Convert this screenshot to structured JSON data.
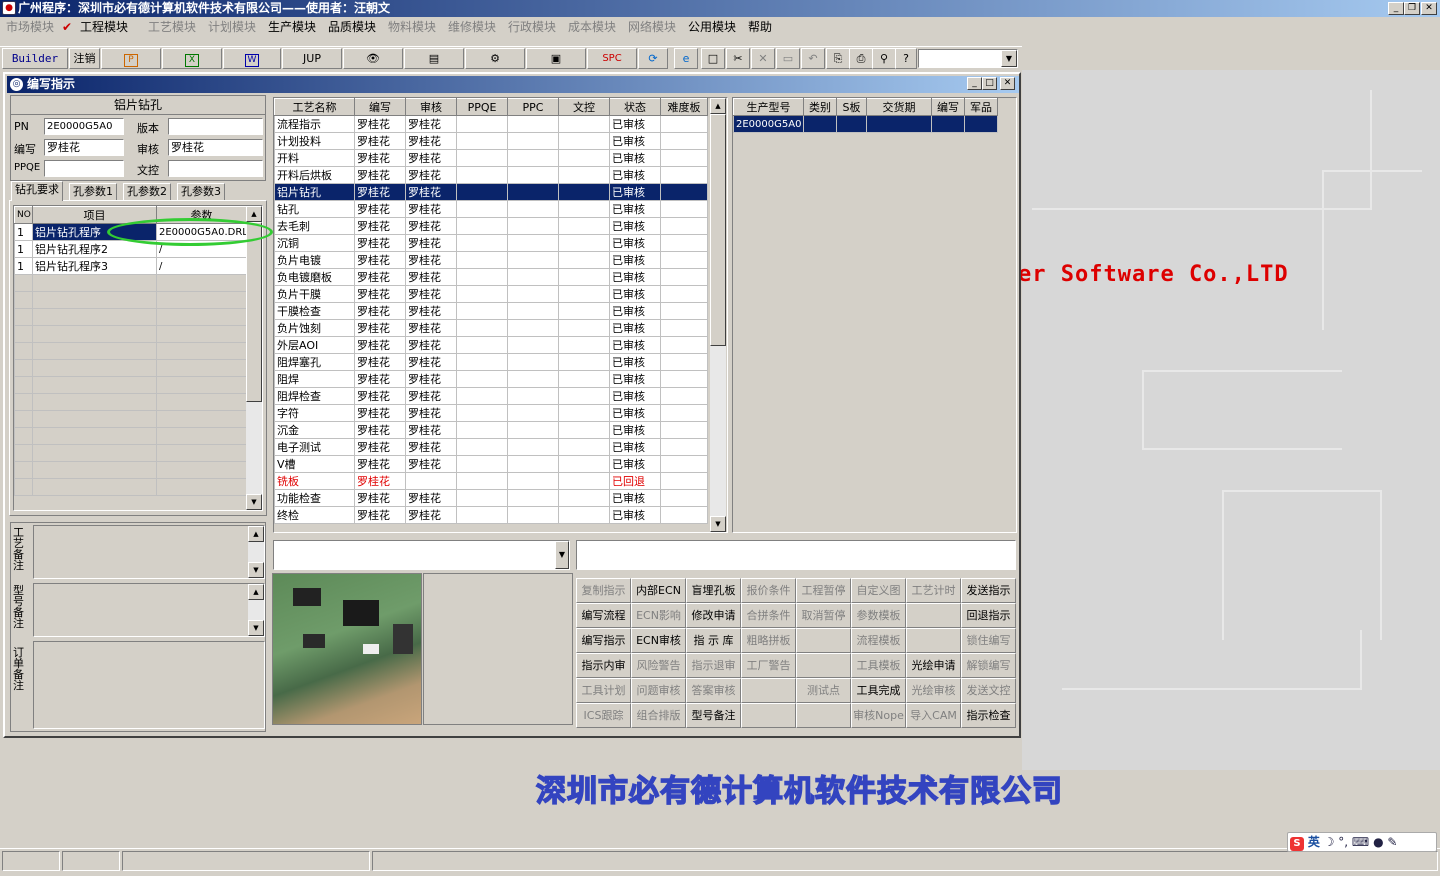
{
  "title": "广州程序：深圳市必有德计算机软件技术有限公司——使用者：汪朝文",
  "menu": [
    {
      "label": "市场模块",
      "enabled": false
    },
    {
      "label": "工程模块",
      "enabled": true
    },
    {
      "label": "工艺模块",
      "enabled": false
    },
    {
      "label": "计划模块",
      "enabled": false
    },
    {
      "label": "生产模块",
      "enabled": true
    },
    {
      "label": "品质模块",
      "enabled": true
    },
    {
      "label": "物料模块",
      "enabled": false
    },
    {
      "label": "维修模块",
      "enabled": false
    },
    {
      "label": "行政模块",
      "enabled": false
    },
    {
      "label": "成本模块",
      "enabled": false
    },
    {
      "label": "网络模块",
      "enabled": false
    },
    {
      "label": "公用模块",
      "enabled": true
    },
    {
      "label": "帮助",
      "enabled": true
    }
  ],
  "toolbar": {
    "builder": "Builder",
    "logout": "注销",
    "jup": "JUP",
    "spc": "SPC"
  },
  "child": {
    "title": "编写指示"
  },
  "left": {
    "header": "铝片钻孔",
    "pn_label": "PN",
    "pn_value": "2E0000G5A0",
    "version_label": "版本",
    "version_value": "",
    "author_label": "编写",
    "author_value": "罗桂花",
    "review_label": "审核",
    "review_value": "罗桂花",
    "ppqe_label": "PPQE",
    "ppqe_value": "",
    "wenkong_label": "文控",
    "wenkong_value": ""
  },
  "tabs": [
    "钻孔要求",
    "孔参数1",
    "孔参数2",
    "孔参数3"
  ],
  "drill": {
    "headers": [
      "NO",
      "项目",
      "参数"
    ],
    "rows": [
      {
        "no": "1",
        "item": "铝片钻孔程序",
        "param": "2E0000G5A0.DRL"
      },
      {
        "no": "1",
        "item": "铝片钻孔程序2",
        "param": "/"
      },
      {
        "no": "1",
        "item": "铝片钻孔程序3",
        "param": "/"
      }
    ]
  },
  "notes": {
    "process": "工艺备注",
    "model": "型号备注",
    "order": "订单备注"
  },
  "proc": {
    "headers": [
      "工艺名称",
      "编写",
      "审核",
      "PPQE",
      "PPC",
      "文控",
      "状态",
      "难度板"
    ],
    "rows": [
      {
        "name": "流程指示",
        "a": "罗桂花",
        "r": "罗桂花",
        "s": "已审核"
      },
      {
        "name": "计划投料",
        "a": "罗桂花",
        "r": "罗桂花",
        "s": "已审核"
      },
      {
        "name": "开料",
        "a": "罗桂花",
        "r": "罗桂花",
        "s": "已审核"
      },
      {
        "name": "开料后烘板",
        "a": "罗桂花",
        "r": "罗桂花",
        "s": "已审核"
      },
      {
        "name": "铝片钻孔",
        "a": "罗桂花",
        "r": "罗桂花",
        "s": "已审核"
      },
      {
        "name": "钻孔",
        "a": "罗桂花",
        "r": "罗桂花",
        "s": "已审核"
      },
      {
        "name": "去毛刺",
        "a": "罗桂花",
        "r": "罗桂花",
        "s": "已审核"
      },
      {
        "name": "沉铜",
        "a": "罗桂花",
        "r": "罗桂花",
        "s": "已审核"
      },
      {
        "name": "负片电镀",
        "a": "罗桂花",
        "r": "罗桂花",
        "s": "已审核"
      },
      {
        "name": "负电镀磨板",
        "a": "罗桂花",
        "r": "罗桂花",
        "s": "已审核"
      },
      {
        "name": "负片干膜",
        "a": "罗桂花",
        "r": "罗桂花",
        "s": "已审核"
      },
      {
        "name": "干膜检查",
        "a": "罗桂花",
        "r": "罗桂花",
        "s": "已审核"
      },
      {
        "name": "负片蚀刻",
        "a": "罗桂花",
        "r": "罗桂花",
        "s": "已审核"
      },
      {
        "name": "外层AOI",
        "a": "罗桂花",
        "r": "罗桂花",
        "s": "已审核"
      },
      {
        "name": "阻焊塞孔",
        "a": "罗桂花",
        "r": "罗桂花",
        "s": "已审核"
      },
      {
        "name": "阻焊",
        "a": "罗桂花",
        "r": "罗桂花",
        "s": "已审核"
      },
      {
        "name": "阻焊检查",
        "a": "罗桂花",
        "r": "罗桂花",
        "s": "已审核"
      },
      {
        "name": "字符",
        "a": "罗桂花",
        "r": "罗桂花",
        "s": "已审核"
      },
      {
        "name": "沉金",
        "a": "罗桂花",
        "r": "罗桂花",
        "s": "已审核"
      },
      {
        "name": "电子测试",
        "a": "罗桂花",
        "r": "罗桂花",
        "s": "已审核"
      },
      {
        "name": "V槽",
        "a": "罗桂花",
        "r": "罗桂花",
        "s": "已审核"
      },
      {
        "name": "铣板",
        "a": "罗桂花",
        "r": "",
        "s": "已回退"
      },
      {
        "name": "功能检查",
        "a": "罗桂花",
        "r": "罗桂花",
        "s": "已审核"
      },
      {
        "name": "终检",
        "a": "罗桂花",
        "r": "罗桂花",
        "s": "已审核"
      }
    ]
  },
  "model": {
    "headers": [
      "生产型号",
      "类别",
      "S板",
      "交货期",
      "编写",
      "军品"
    ],
    "rows": [
      {
        "model": "2E0000G5A0"
      }
    ]
  },
  "buttons": [
    [
      "复制指示",
      "内部ECN",
      "盲埋孔板",
      "报价条件",
      "工程暂停",
      "自定义图",
      "工艺计时",
      "发送指示"
    ],
    [
      "编写流程",
      "ECN影响",
      "修改申请",
      "合拼条件",
      "取消暂停",
      "参数模板",
      "",
      "回退指示"
    ],
    [
      "编写指示",
      "ECN审核",
      "指 示 库",
      "粗略拼板",
      "",
      "流程模板",
      "",
      "锁住编写"
    ],
    [
      "指示内审",
      "风险警告",
      "指示退审",
      "工厂警告",
      "",
      "工具模板",
      "光绘申请",
      "解锁编写"
    ],
    [
      "工具计划",
      "问题审核",
      "答案审核",
      "",
      "测试点",
      "工具完成",
      "光绘审核",
      "发送文控"
    ],
    [
      "ICS跟踪",
      "组合排版",
      "型号备注",
      "",
      "",
      "审核Nope",
      "导入CAM",
      "指示检查"
    ]
  ],
  "button_enabled": [
    [
      false,
      true,
      true,
      false,
      false,
      false,
      false,
      true
    ],
    [
      true,
      false,
      true,
      false,
      false,
      false,
      false,
      true
    ],
    [
      true,
      true,
      true,
      false,
      false,
      false,
      false,
      false
    ],
    [
      true,
      false,
      false,
      false,
      false,
      false,
      true,
      false
    ],
    [
      false,
      false,
      false,
      false,
      false,
      true,
      false,
      false
    ],
    [
      false,
      false,
      true,
      false,
      false,
      false,
      false,
      true
    ]
  ],
  "desktop": {
    "brand": "er Software Co.,LTD",
    "company": "深圳市必有德计算机软件技术有限公司"
  },
  "ime": {
    "text": "英"
  }
}
